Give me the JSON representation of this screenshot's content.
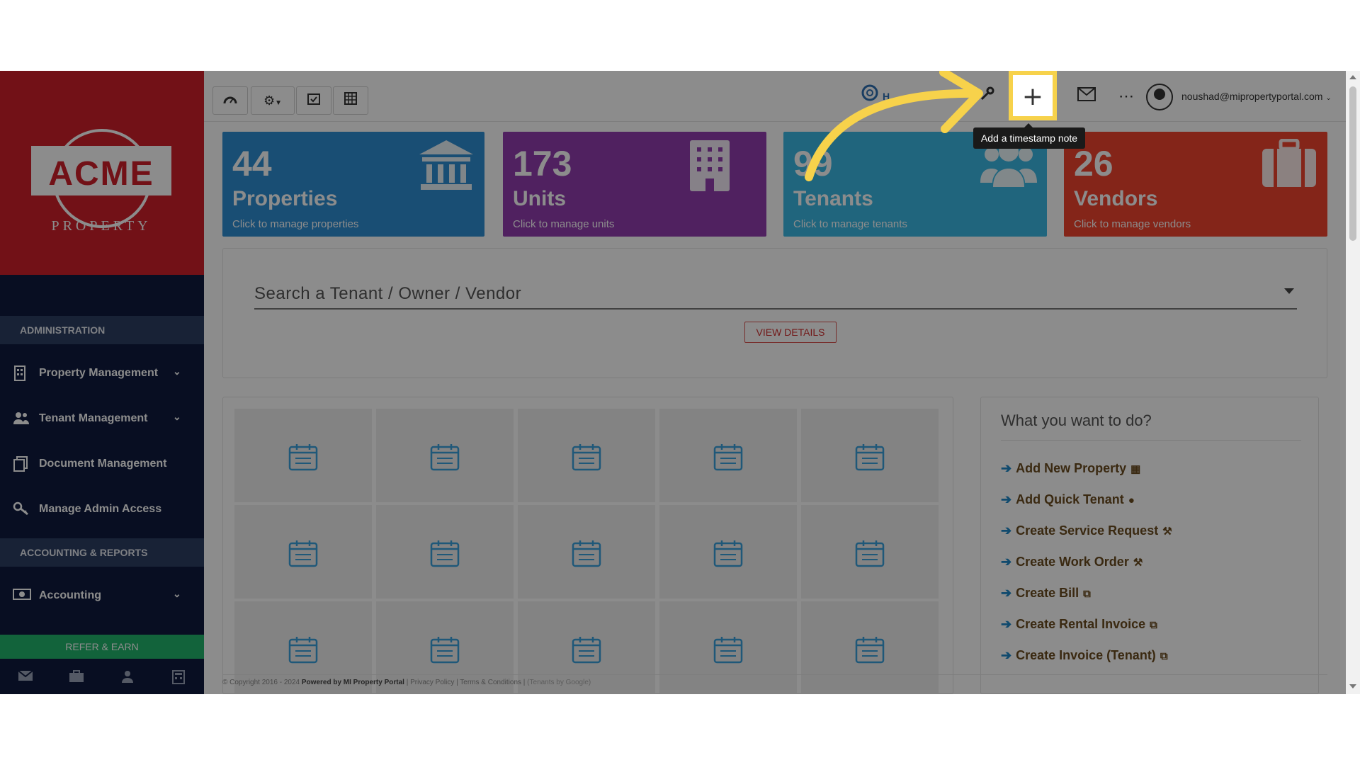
{
  "app": {
    "brand": "ACME",
    "brand_sub": "PROPERTY"
  },
  "sidebar": {
    "sections": [
      {
        "header": "ADMINISTRATION",
        "items": [
          {
            "label": "Property Management",
            "icon": "building-icon",
            "has_chevron": true
          },
          {
            "label": "Tenant Management",
            "icon": "users-icon",
            "has_chevron": true
          },
          {
            "label": "Document Management",
            "icon": "documents-icon",
            "has_chevron": false
          },
          {
            "label": "Manage Admin Access",
            "icon": "key-icon",
            "has_chevron": false
          }
        ]
      },
      {
        "header": "ACCOUNTING & REPORTS",
        "items": [
          {
            "label": "Accounting",
            "icon": "money-icon",
            "has_chevron": true
          }
        ]
      }
    ],
    "refer_label": "REFER & EARN",
    "bottom_icons": [
      "mail-icon",
      "briefcase-icon",
      "user-icon",
      "calculator-icon"
    ]
  },
  "topbar": {
    "left_buttons": [
      "dashboard-icon",
      "gear-icon",
      "calendar-check-icon",
      "calculator-icon"
    ],
    "help_partial": "H",
    "right_icons": [
      "wrench-icon",
      "plus-icon",
      "mail-icon",
      "more-icon"
    ],
    "user_email": "noushad@mipropertyportal.com",
    "tooltip": "Add a timestamp note"
  },
  "stats": [
    {
      "number": "44",
      "name": "Properties",
      "sub": "Click to manage properties",
      "color": "#2f8fd3",
      "icon": "bank-icon"
    },
    {
      "number": "173",
      "name": "Units",
      "sub": "Click to manage units",
      "color": "#923db0",
      "icon": "office-building-icon"
    },
    {
      "number": "99",
      "name": "Tenants",
      "sub": "Click to manage tenants",
      "color": "#3bb8e3",
      "icon": "users-icon"
    },
    {
      "number": "26",
      "name": "Vendors",
      "sub": "Click to manage vendors",
      "color": "#f0442f",
      "icon": "briefcase-icon"
    }
  ],
  "search": {
    "placeholder": "Search a Tenant / Owner / Vendor",
    "button_label": "VIEW DETAILS"
  },
  "todo": {
    "title": "What you want to do?",
    "items": [
      {
        "label": "Add New Property",
        "icon": "building-icon"
      },
      {
        "label": "Add Quick Tenant",
        "icon": "user-icon"
      },
      {
        "label": "Create Service Request",
        "icon": "wrench-icon"
      },
      {
        "label": "Create Work Order",
        "icon": "wrench-icon"
      },
      {
        "label": "Create Bill",
        "icon": "copy-icon"
      },
      {
        "label": "Create Rental Invoice",
        "icon": "copy-icon"
      },
      {
        "label": "Create Invoice (Tenant)",
        "icon": "copy-icon"
      }
    ]
  },
  "footer": {
    "copyright": "© Copyright 2016 - 2024",
    "powered": "Powered by MI Property Portal",
    "links": "| Privacy Policy | Terms & Conditions |",
    "tenant_by": "(Tenants by Google)"
  },
  "colors": {
    "accent_highlight": "#f7d24b",
    "brand_red": "#cf1f2a",
    "sidebar_bg": "#0f1b3e"
  }
}
